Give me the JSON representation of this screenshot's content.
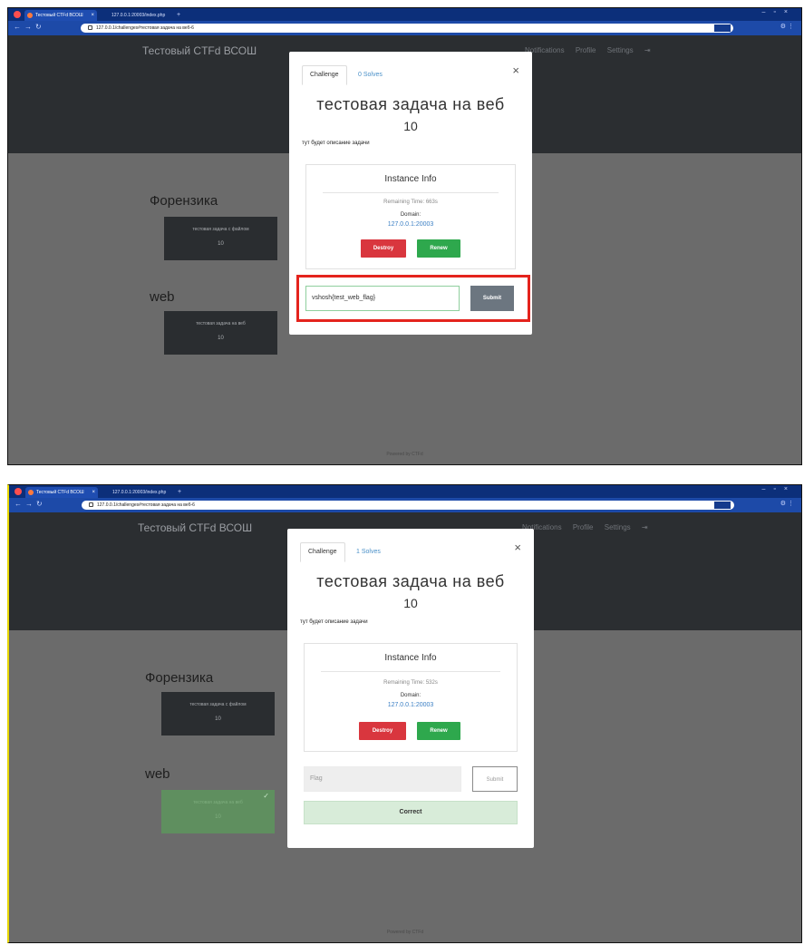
{
  "browser": {
    "tabs": [
      "Тестовый CTFd ВСОШ",
      "127.0.0.1:20003/index.php"
    ],
    "url_top": "127.0.0.1/challenges#тестовая задача на веб-6",
    "url_bottom": "127.0.0.1/challenges#тестовая задача на веб-6"
  },
  "site": {
    "brand": "Тестовый CTFd ВСОШ",
    "nav_right": [
      "Notifications",
      "Profile",
      "Settings"
    ],
    "footer": "Powered by CTFd"
  },
  "categories": [
    {
      "name": "Форензика",
      "challenge": "тестовая задача с файлом",
      "value": "10"
    },
    {
      "name": "web",
      "challenge": "тестовая задача на веб",
      "value": "10"
    }
  ],
  "modal_before": {
    "tab_challenge": "Challenge",
    "tab_solves": "0 Solves",
    "title": "тестовая задача на веб",
    "value": "10",
    "description": "тут будет описание задачи",
    "instance_title": "Instance Info",
    "remaining": "Remaining Time: 663s",
    "domain_label": "Domain:",
    "domain": "127.0.0.1:20003",
    "destroy": "Destroy",
    "renew": "Renew",
    "flag_value": "vshosh{test_web_flag}",
    "submit": "Submit"
  },
  "modal_after": {
    "tab_challenge": "Challenge",
    "tab_solves": "1 Solves",
    "title": "тестовая задача на веб",
    "value": "10",
    "description": "тут будет описание задачи",
    "instance_title": "Instance Info",
    "remaining": "Remaining Time: 532s",
    "domain_label": "Domain:",
    "domain": "127.0.0.1:20003",
    "destroy": "Destroy",
    "renew": "Renew",
    "flag_placeholder": "Flag",
    "submit": "Submit",
    "result": "Correct"
  },
  "colors": {
    "highlight": "#e4231d",
    "solved_card": "#5f8f5f",
    "destroy": "#d9363e",
    "renew": "#2ea84d"
  }
}
